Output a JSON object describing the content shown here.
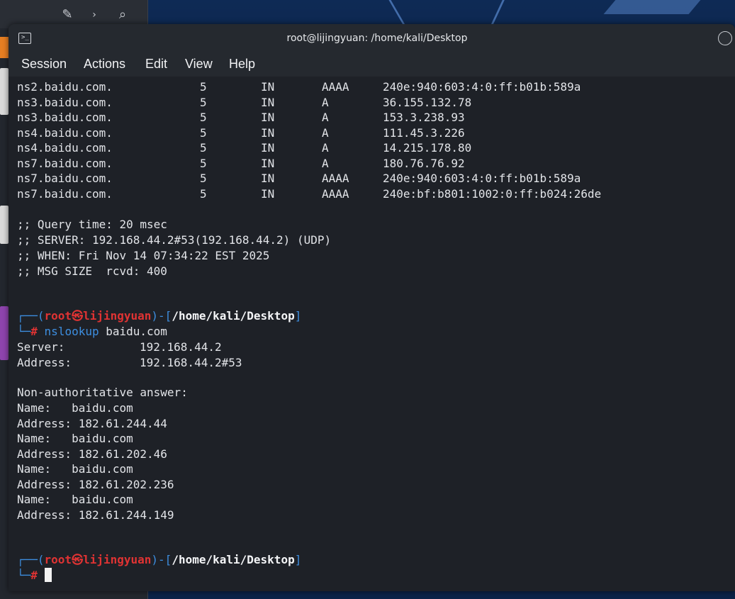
{
  "window": {
    "title": "root@lijingyuan: /home/kali/Desktop"
  },
  "menu": [
    "Session",
    "Actions",
    "Edit",
    "View",
    "Help"
  ],
  "dns_records": [
    {
      "name": "ns2.baidu.com.",
      "ttl": "5",
      "class": "IN",
      "type": "AAAA",
      "value": "240e:940:603:4:0:ff:b01b:589a"
    },
    {
      "name": "ns3.baidu.com.",
      "ttl": "5",
      "class": "IN",
      "type": "A",
      "value": "36.155.132.78"
    },
    {
      "name": "ns3.baidu.com.",
      "ttl": "5",
      "class": "IN",
      "type": "A",
      "value": "153.3.238.93"
    },
    {
      "name": "ns4.baidu.com.",
      "ttl": "5",
      "class": "IN",
      "type": "A",
      "value": "111.45.3.226"
    },
    {
      "name": "ns4.baidu.com.",
      "ttl": "5",
      "class": "IN",
      "type": "A",
      "value": "14.215.178.80"
    },
    {
      "name": "ns7.baidu.com.",
      "ttl": "5",
      "class": "IN",
      "type": "A",
      "value": "180.76.76.92"
    },
    {
      "name": "ns7.baidu.com.",
      "ttl": "5",
      "class": "IN",
      "type": "AAAA",
      "value": "240e:940:603:4:0:ff:b01b:589a"
    },
    {
      "name": "ns7.baidu.com.",
      "ttl": "5",
      "class": "IN",
      "type": "AAAA",
      "value": "240e:bf:b801:1002:0:ff:b024:26de"
    }
  ],
  "query_stats": [
    ";; Query time: 20 msec",
    ";; SERVER: 192.168.44.2#53(192.168.44.2) (UDP)",
    ";; WHEN: Fri Nov 14 07:34:22 EST 2025",
    ";; MSG SIZE  rcvd: 400"
  ],
  "prompt": {
    "open": "┌──(",
    "user": "root",
    "at": "㉿",
    "host": "lijingyuan",
    "mid": ")-[",
    "path": "/home/kali/Desktop",
    "close": "]",
    "second": "└─",
    "hash": "#"
  },
  "command": {
    "name": "nslookup",
    "arg": " baidu.com"
  },
  "nslookup": {
    "server_label": "Server:",
    "server_value": "192.168.44.2",
    "address_label": "Address:",
    "address_value": "192.168.44.2#53",
    "answer_header": "Non-authoritative answer:",
    "answers": [
      {
        "name_line": "Name:   baidu.com",
        "addr_line": "Address: 182.61.244.44"
      },
      {
        "name_line": "Name:   baidu.com",
        "addr_line": "Address: 182.61.202.46"
      },
      {
        "name_line": "Name:   baidu.com",
        "addr_line": "Address: 182.61.202.236"
      },
      {
        "name_line": "Name:   baidu.com",
        "addr_line": "Address: 182.61.244.149"
      }
    ]
  },
  "colors": {
    "terminal_bg": "#1e2127",
    "prompt_blue": "#3d8ee0",
    "prompt_red": "#e03333"
  }
}
